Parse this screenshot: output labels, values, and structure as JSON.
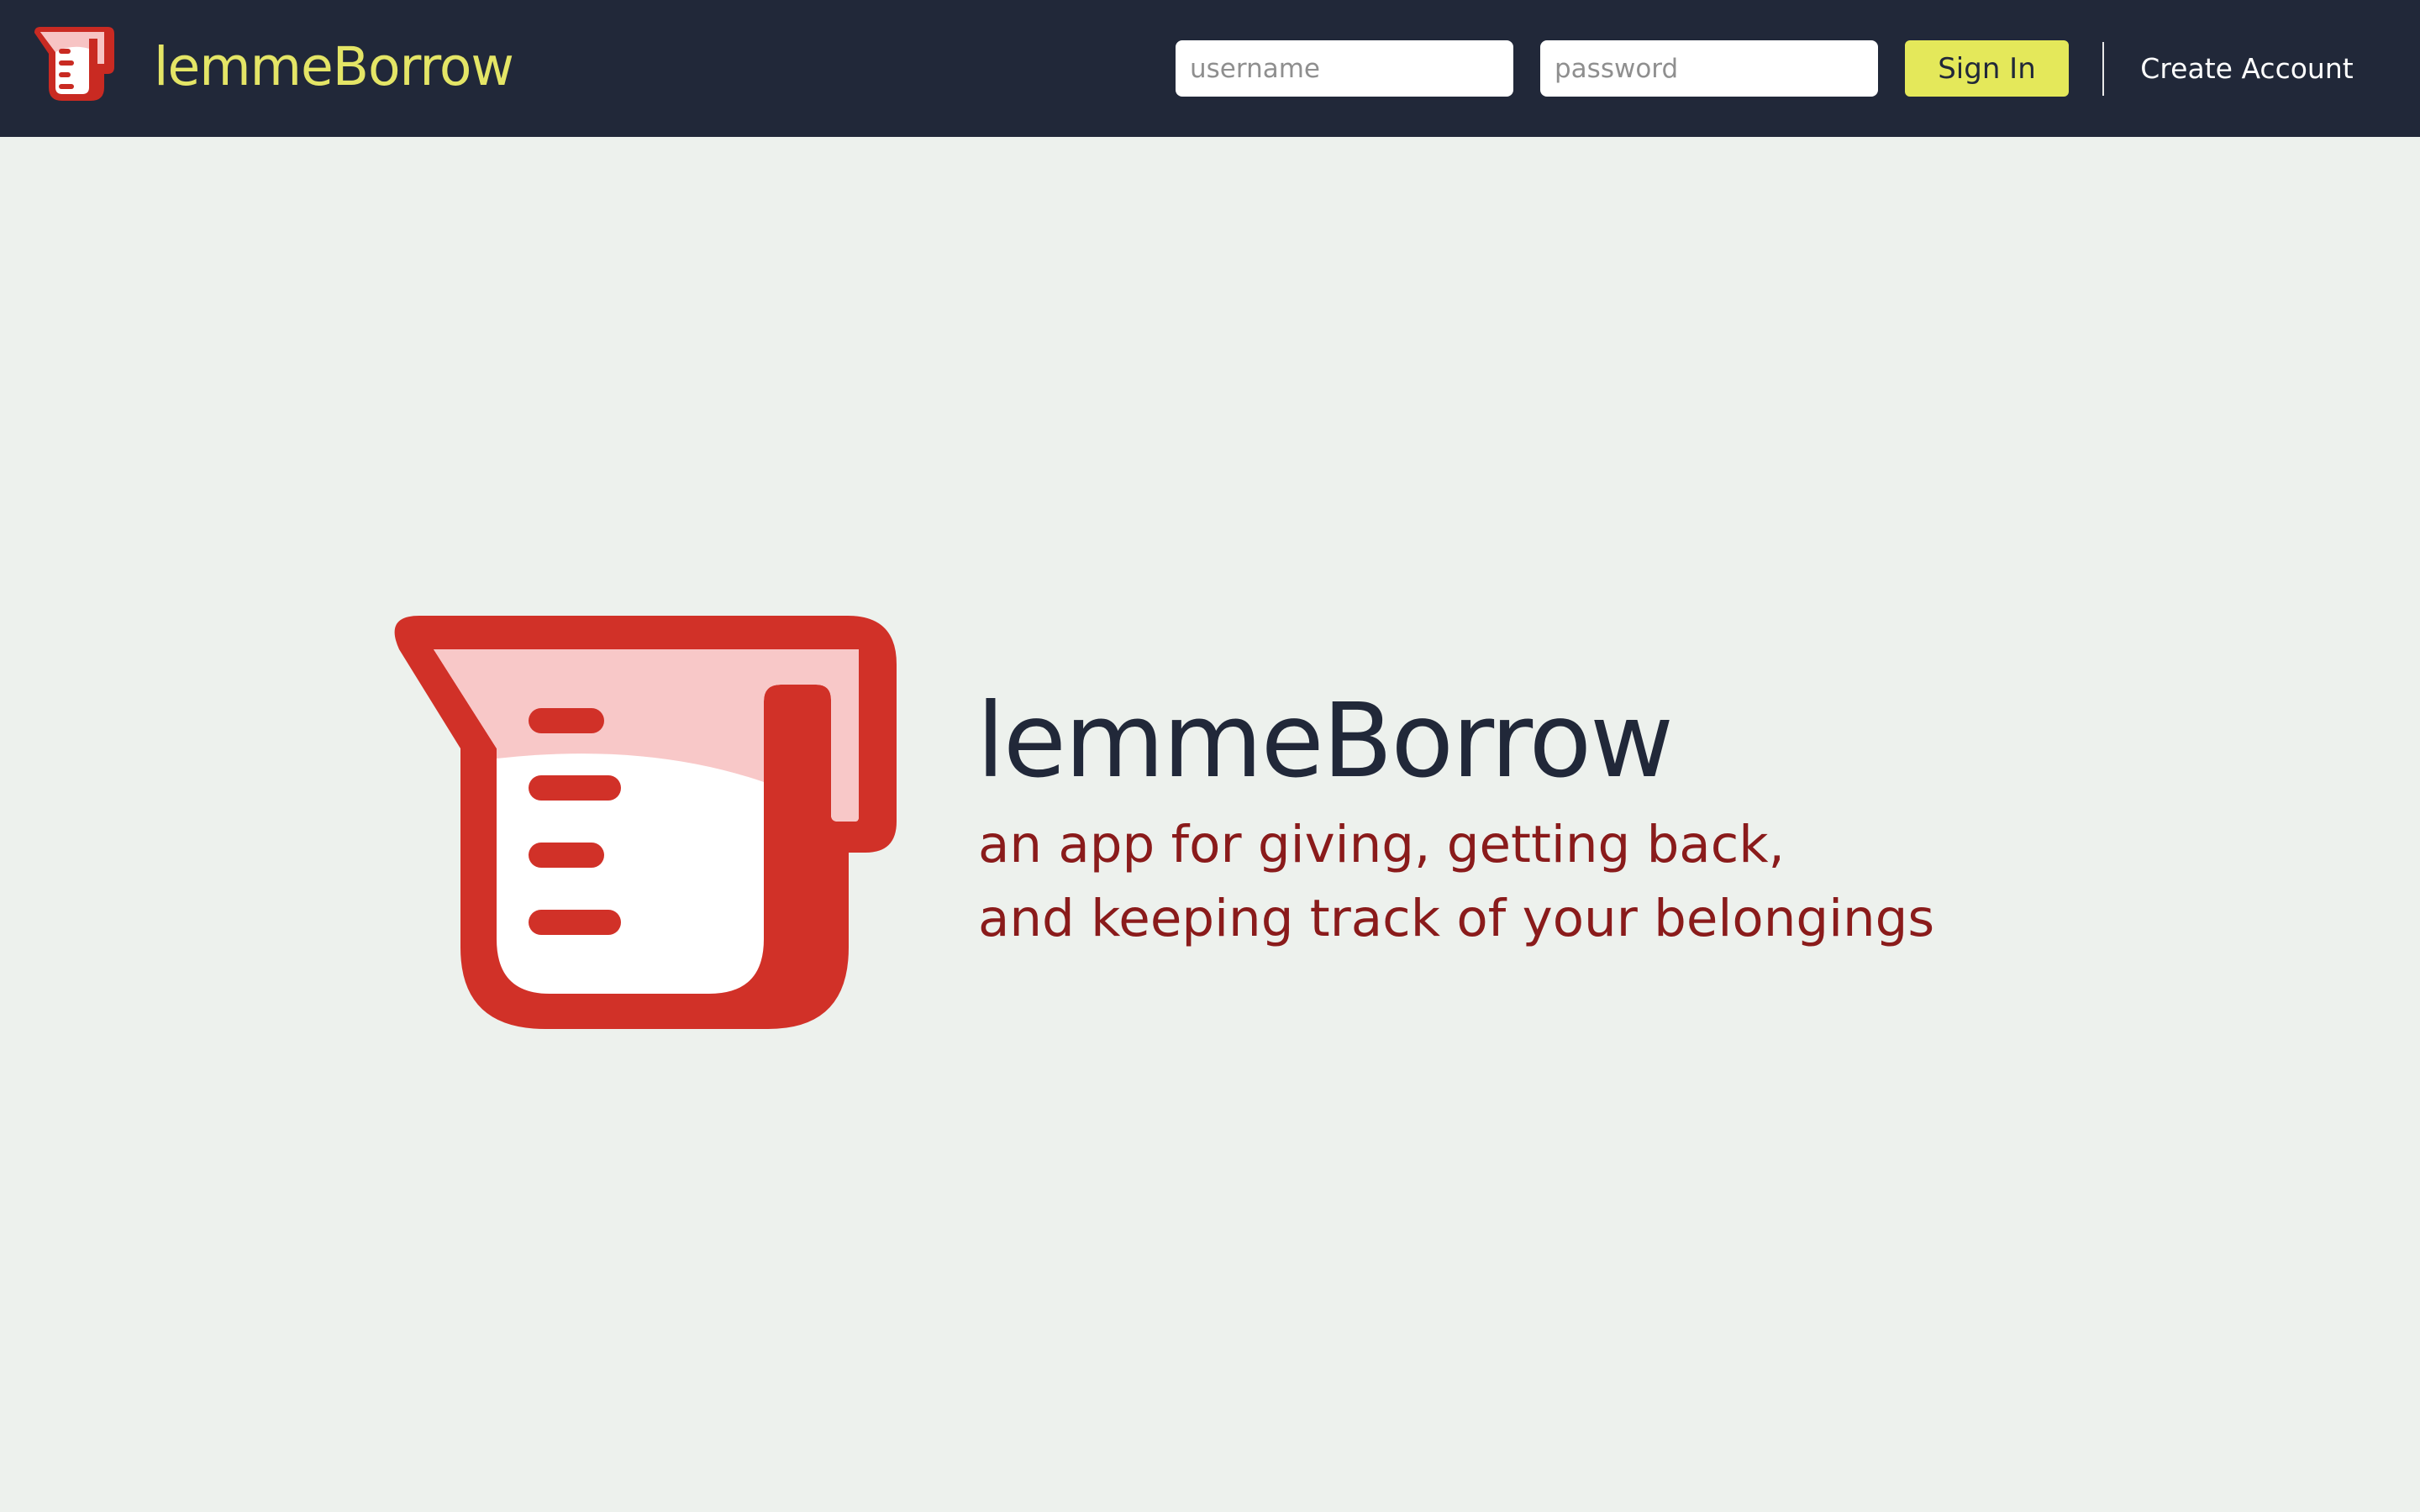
{
  "header": {
    "brand": "lemmeBorrow",
    "logo_icon": "measuring-cup-icon",
    "username_placeholder": "username",
    "password_placeholder": "password",
    "signin_label": "Sign In",
    "create_account_label": "Create Account"
  },
  "hero": {
    "title": "lemmeBorrow",
    "tagline_line1": "an app for giving, getting back,",
    "tagline_line2": "and keeping track of your belongings",
    "logo_icon": "measuring-cup-icon"
  },
  "colors": {
    "navbar_bg": "#212839",
    "brand_yellow": "#e4e566",
    "button_yellow": "#e4e85a",
    "page_bg": "#edf1ed",
    "logo_red": "#d13128",
    "logo_pink": "#f8c8c8",
    "tagline_red": "#8a1b1b",
    "title_navy": "#212839"
  }
}
